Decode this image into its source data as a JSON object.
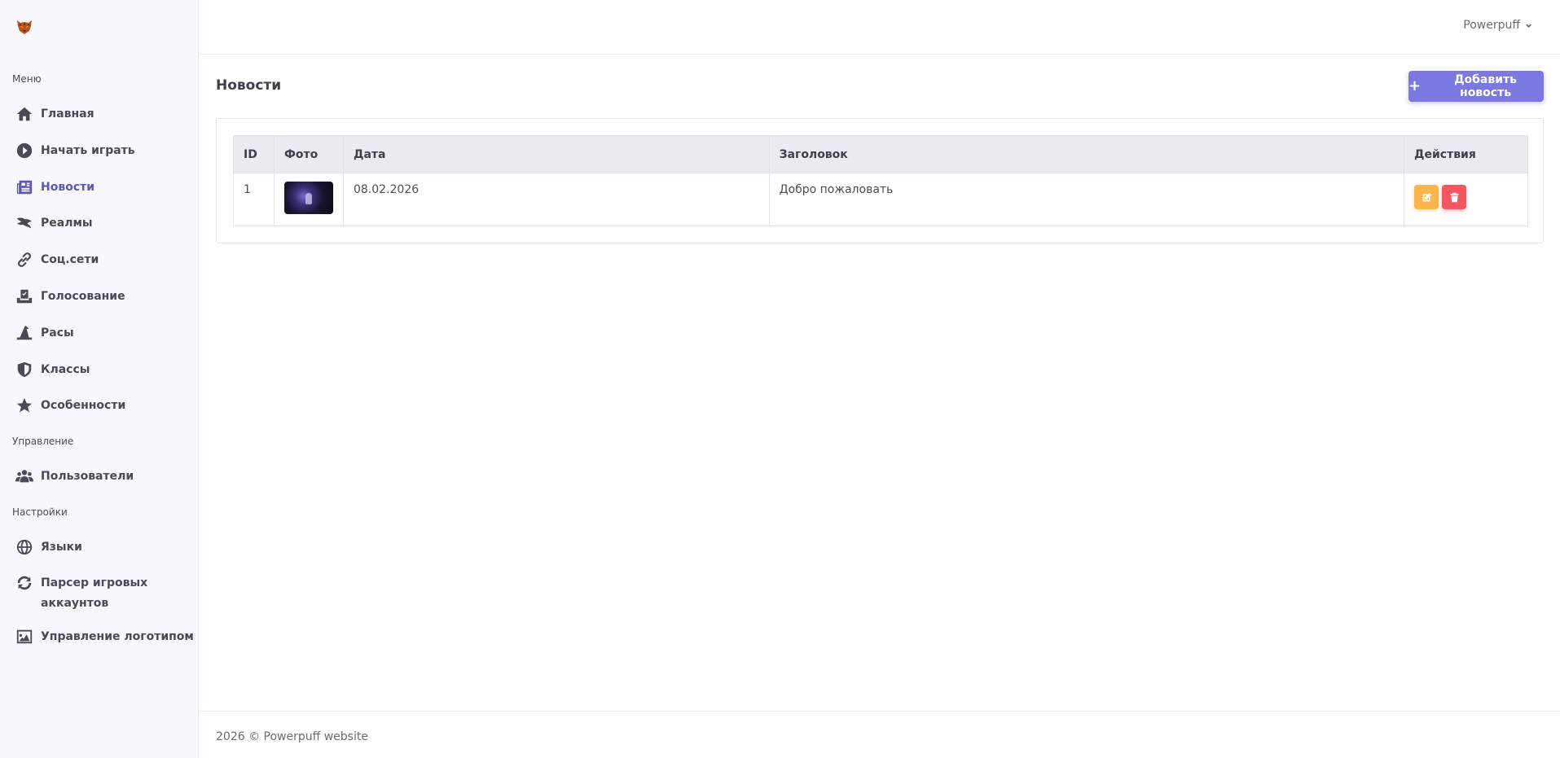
{
  "app": {
    "logo_icon": "tiger-head-icon"
  },
  "sidebar": {
    "sections": {
      "menu": "Меню",
      "management": "Управление",
      "settings": "Настройки"
    },
    "items": [
      {
        "label": "Главная",
        "icon": "home-icon"
      },
      {
        "label": "Начать играть",
        "icon": "play-circle-icon"
      },
      {
        "label": "Новости",
        "icon": "newspaper-icon",
        "active": true
      },
      {
        "label": "Реалмы",
        "icon": "dragon-icon"
      },
      {
        "label": "Соц.сети",
        "icon": "link-icon"
      },
      {
        "label": "Голосование",
        "icon": "vote-box-icon"
      },
      {
        "label": "Расы",
        "icon": "wizard-hat-icon"
      },
      {
        "label": "Классы",
        "icon": "shield-icon"
      },
      {
        "label": "Особенности",
        "icon": "star-icon"
      },
      {
        "label": "Пользователи",
        "icon": "users-icon"
      },
      {
        "label": "Языки",
        "icon": "globe-icon"
      },
      {
        "label": "Парсер игровых аккаунтов",
        "icon": "sync-icon"
      },
      {
        "label": "Управление логотипом",
        "icon": "image-icon"
      }
    ]
  },
  "topbar": {
    "user_name": "Powerpuff"
  },
  "main": {
    "title": "Новости",
    "add_button": "Добавить новость",
    "table": {
      "headers": [
        "ID",
        "Фото",
        "Дата",
        "Заголовок",
        "Действия"
      ],
      "rows": [
        {
          "id": "1",
          "date": "08.02.2026",
          "title": "Добро пожаловать"
        }
      ]
    }
  },
  "footer": {
    "text": "2026 © Powerpuff website"
  },
  "colors": {
    "accent": "#7b78e1",
    "edit": "#fdb44b",
    "delete": "#f4555f",
    "active_nav": "#5b58b0"
  }
}
